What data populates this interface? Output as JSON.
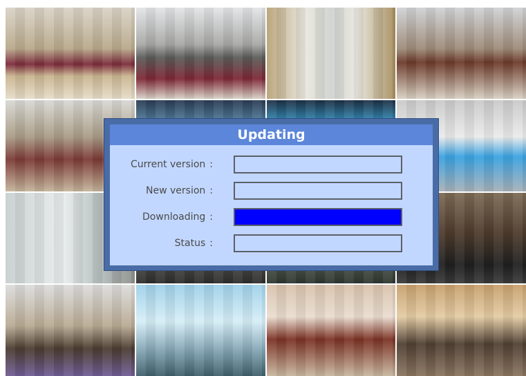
{
  "dialog": {
    "title": "Updating",
    "fields": {
      "current_version": {
        "label": "Current version",
        "value": ""
      },
      "new_version": {
        "label": "New version",
        "value": ""
      },
      "downloading": {
        "label": "Downloading",
        "progress_fraction": 1.0
      },
      "status": {
        "label": "Status",
        "value": ""
      }
    },
    "separator": ":"
  },
  "colors": {
    "dialog_frame": "#4a6ca6",
    "dialog_title_bar": "#5b86d9",
    "dialog_body": "#c2d7ff",
    "progress_fill": "#0000ff",
    "field_border": "#5a5f6a"
  },
  "background": {
    "camera_tiles": [
      "lobby",
      "office",
      "doors",
      "branch",
      "waiting",
      "blue1",
      "blue2",
      "reception",
      "glass",
      "dark1",
      "dark2",
      "ceo",
      "hall",
      "corridor",
      "elev",
      "conf"
    ]
  }
}
